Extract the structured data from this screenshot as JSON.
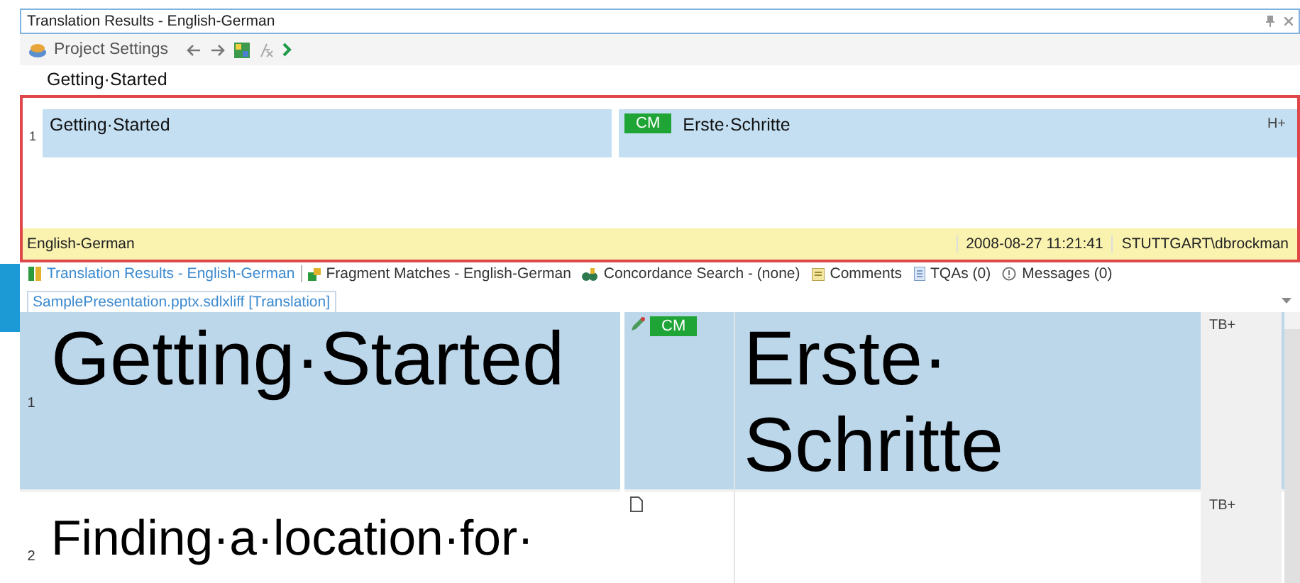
{
  "panel": {
    "title": "Translation Results - English-German",
    "toolbar": {
      "project_settings": "Project Settings"
    },
    "source_text": "Getting·Started",
    "match": {
      "number": "1",
      "source": "Getting·Started",
      "badge": "CM",
      "target": "Erste·Schritte",
      "flag": "H+"
    },
    "status_bar": {
      "language_pair": "English-German",
      "date": "2008-08-27 11:21:41",
      "user": "STUTTGART\\dbrockman"
    }
  },
  "view_tabs": [
    {
      "label": "Translation Results - English-German",
      "selected": true
    },
    {
      "label": "Fragment Matches - English-German",
      "selected": false
    },
    {
      "label": "Concordance Search - (none)",
      "selected": false
    },
    {
      "label": "Comments",
      "selected": false
    },
    {
      "label": "TQAs (0)",
      "selected": false
    },
    {
      "label": "Messages (0)",
      "selected": false
    }
  ],
  "document_tab": {
    "label": "SamplePresentation.pptx.sdlxliff [Translation]"
  },
  "segments": [
    {
      "number": "1",
      "source": "Getting·Started",
      "status": {
        "kind": "translated",
        "badge": "CM"
      },
      "target": "Erste·Schritte",
      "flag": "TB+",
      "selected": true
    },
    {
      "number": "2",
      "source": "Finding·a·location·for·",
      "status": {
        "kind": "untranslated"
      },
      "flag": "TB+",
      "selected": false
    }
  ]
}
